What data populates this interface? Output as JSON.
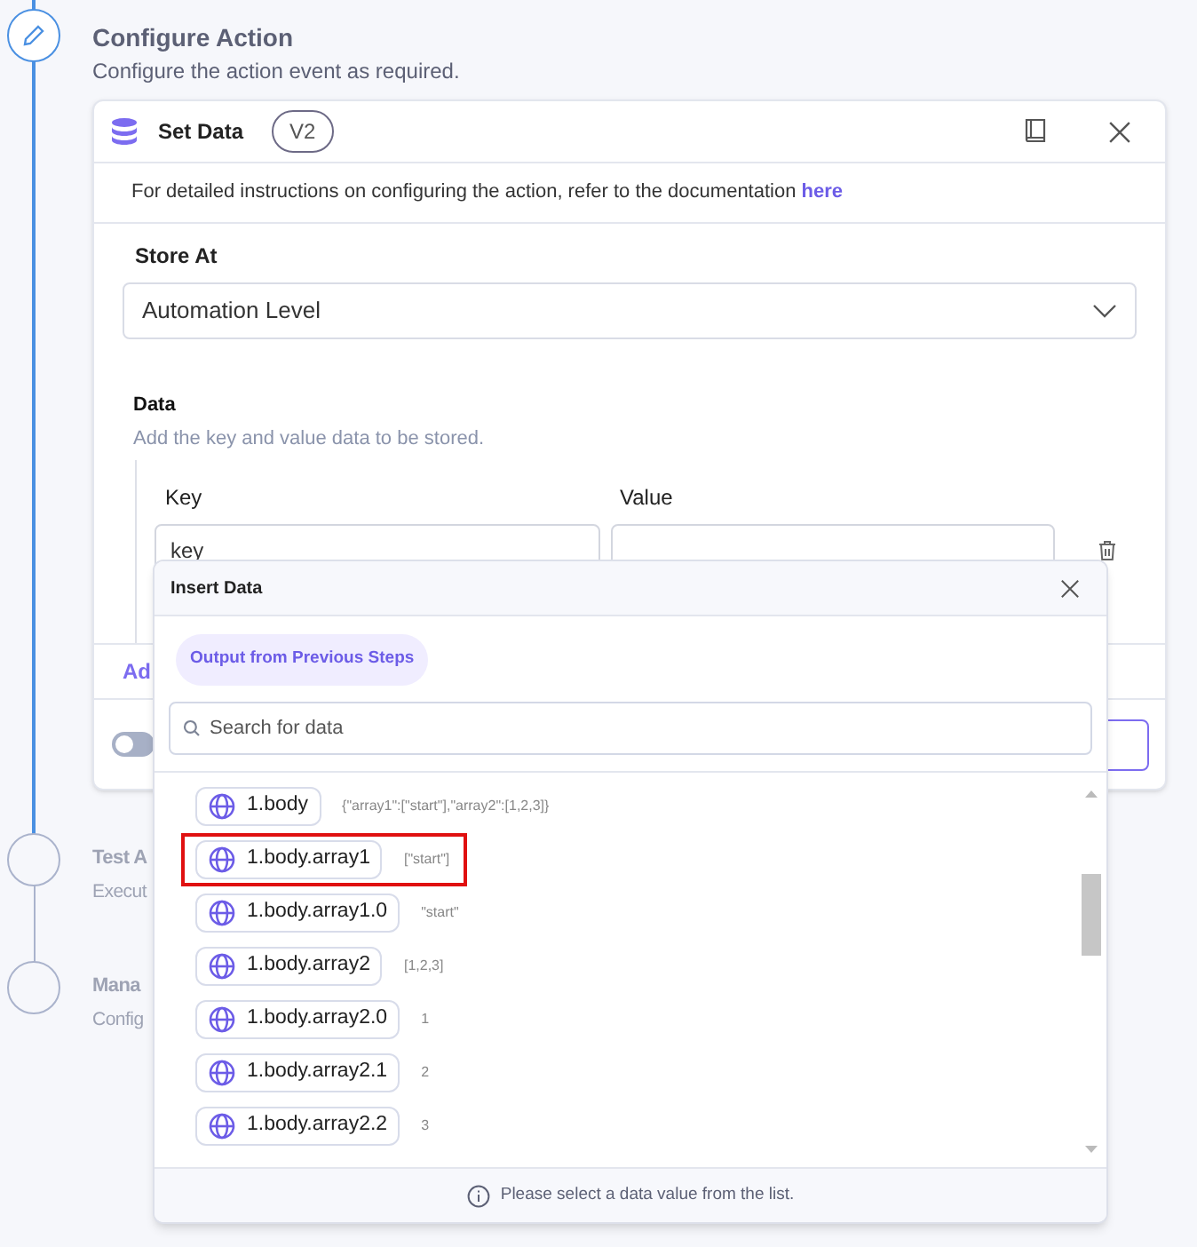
{
  "steps": [
    {
      "title": "Configure Action",
      "description": "Configure the action event as required.",
      "active": true
    },
    {
      "title": "Test A",
      "description": "Execut",
      "active": false
    },
    {
      "title": "Mana",
      "description": "Config",
      "active": false
    }
  ],
  "card": {
    "title": "Set Data",
    "version": "V2",
    "info": "For detailed instructions on configuring the action, refer to the documentation",
    "info_link": "here",
    "store_at": {
      "label": "Store At",
      "value": "Automation Level"
    },
    "data": {
      "label": "Data",
      "hint": "Add the key and value data to be stored.",
      "columns": [
        "Key",
        "Value"
      ],
      "rows": [
        {
          "key": "key",
          "value": ""
        }
      ]
    },
    "add_link": "Ad",
    "toggle": {
      "on": false
    }
  },
  "popover": {
    "title": "Insert Data",
    "tabs": [
      {
        "label": "Output from Previous Steps",
        "selected": true
      }
    ],
    "search": {
      "placeholder": "Search for data"
    },
    "items": [
      {
        "label": "1.body",
        "value": "{\"array1\":[\"start\"],\"array2\":[1,2,3]}",
        "selected": false
      },
      {
        "label": "1.body.array1",
        "value": "[\"start\"]",
        "selected": true
      },
      {
        "label": "1.body.array1.0",
        "value": "\"start\"",
        "selected": false
      },
      {
        "label": "1.body.array2",
        "value": "[1,2,3]",
        "selected": false
      },
      {
        "label": "1.body.array2.0",
        "value": "1",
        "selected": false
      },
      {
        "label": "1.body.array2.1",
        "value": "2",
        "selected": false
      },
      {
        "label": "1.body.array2.2",
        "value": "3",
        "selected": false
      }
    ],
    "footer": "Please select a data value from the list."
  }
}
